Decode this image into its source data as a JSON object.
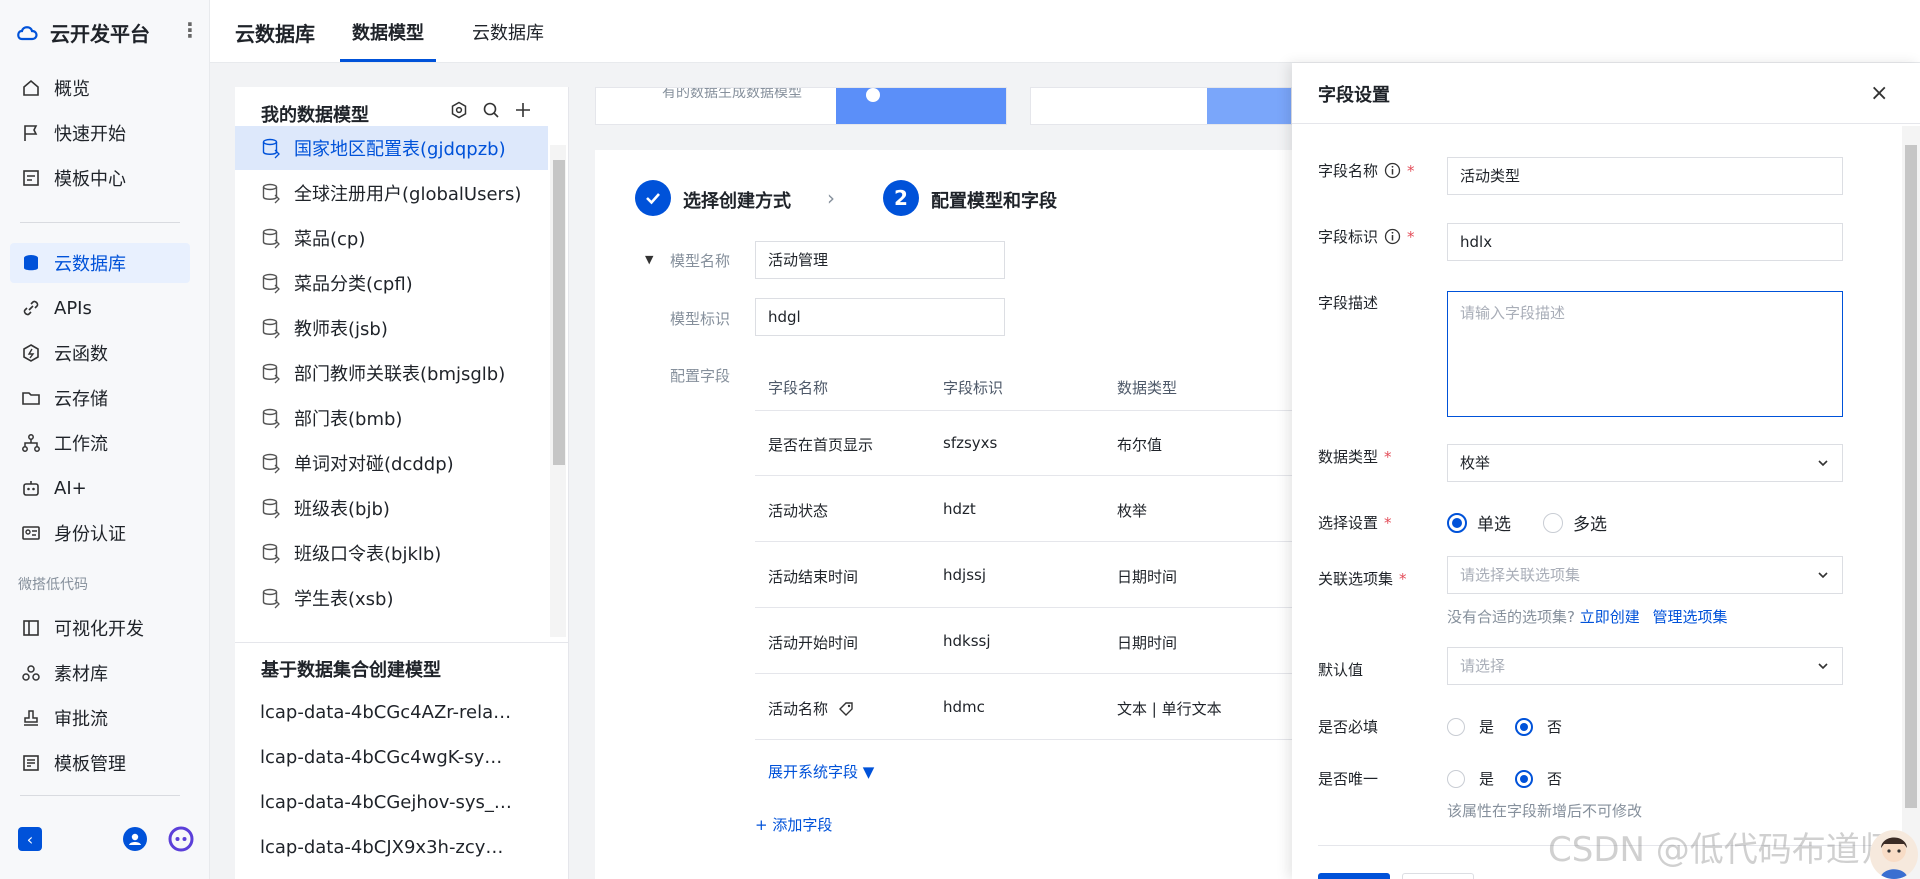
{
  "brand": {
    "name": "云开发平台"
  },
  "nav": {
    "items_top": [
      {
        "label": "概览",
        "icon": "home-icon"
      },
      {
        "label": "快速开始",
        "icon": "flag-icon"
      },
      {
        "label": "模板中心",
        "icon": "template-icon"
      }
    ],
    "items_main": [
      {
        "label": "云数据库",
        "icon": "database-icon",
        "active": true
      },
      {
        "label": "APIs",
        "icon": "link-icon"
      },
      {
        "label": "云函数",
        "icon": "function-icon"
      },
      {
        "label": "云存储",
        "icon": "folder-icon"
      },
      {
        "label": "工作流",
        "icon": "workflow-icon"
      },
      {
        "label": "AI+",
        "icon": "robot-icon"
      },
      {
        "label": "身份认证",
        "icon": "id-card-icon"
      }
    ],
    "group_label": "微搭低代码",
    "items_lowcode": [
      {
        "label": "可视化开发",
        "icon": "layout-icon"
      },
      {
        "label": "素材库",
        "icon": "assets-icon"
      },
      {
        "label": "审批流",
        "icon": "stamp-icon"
      },
      {
        "label": "模板管理",
        "icon": "template-manage-icon"
      }
    ]
  },
  "topbar": {
    "title": "云数据库",
    "tabs": [
      {
        "label": "数据模型",
        "active": true
      },
      {
        "label": "云数据库",
        "active": false
      }
    ]
  },
  "models": {
    "title": "我的数据模型",
    "items": [
      "国家地区配置表(gjdqpzb)",
      "全球注册用户(globalUsers)",
      "菜品(cp)",
      "菜品分类(cpfl)",
      "教师表(jsb)",
      "部门教师关联表(bmjsglb)",
      "部门表(bmb)",
      "单词对对碰(dcddp)",
      "班级表(bjb)",
      "班级口令表(bjklb)",
      "学生表(xsb)"
    ],
    "dataset_title": "基于数据集合创建模型",
    "datasets": [
      "lcap-data-4bCGc4AZr-rela…",
      "lcap-data-4bCGc4wgK-sy…",
      "lcap-data-4bCGejhov-sys_…",
      "lcap-data-4bCJX9x3h-zcy…"
    ]
  },
  "topcard": {
    "text": "有的数据生成数据模型"
  },
  "steps": {
    "step1": "选择创建方式",
    "step2_num": "2",
    "step2": "配置模型和字段"
  },
  "form": {
    "model_name_label": "模型名称",
    "model_name_value": "活动管理",
    "model_id_label": "模型标识",
    "model_id_value": "hdgl",
    "fields_label": "配置字段"
  },
  "table": {
    "headers": [
      "字段名称",
      "字段标识",
      "数据类型"
    ],
    "rows": [
      [
        "是否在首页显示",
        "sfzsyxs",
        "布尔值"
      ],
      [
        "活动状态",
        "hdzt",
        "枚举"
      ],
      [
        "活动结束时间",
        "hdjssj",
        "日期时间"
      ],
      [
        "活动开始时间",
        "hdkssj",
        "日期时间"
      ],
      [
        "活动名称",
        "hdmc",
        "文本 | 单行文本"
      ]
    ],
    "expand_system": "展开系统字段 ▼",
    "add_field": "+ 添加字段"
  },
  "drawer": {
    "title": "字段设置",
    "field_name_label": "字段名称",
    "field_name_value": "活动类型",
    "field_id_label": "字段标识",
    "field_id_value": "hdlx",
    "desc_label": "字段描述",
    "desc_placeholder": "请输入字段描述",
    "data_type_label": "数据类型",
    "data_type_value": "枚举",
    "select_label": "选择设置",
    "single": "单选",
    "multi": "多选",
    "option_set_label": "关联选项集",
    "option_set_placeholder": "请选择关联选项集",
    "option_hint": "没有合适的选项集?",
    "create_now": "立即创建",
    "manage_sets": "管理选项集",
    "default_label": "默认值",
    "default_placeholder": "请选择",
    "required_label": "是否必填",
    "unique_label": "是否唯一",
    "yes": "是",
    "no": "否",
    "unique_hint": "该属性在字段新增后不可修改"
  },
  "watermark": "CSDN @低代码布道师",
  "colors": {
    "accent": "#0052d9",
    "required": "#e34d59"
  }
}
